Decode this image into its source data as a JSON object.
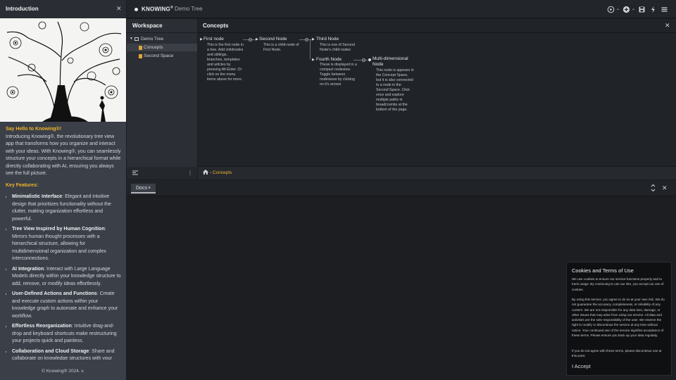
{
  "intro": {
    "title": "Introduction",
    "hello": "Say Hello to Knowing®!",
    "intro_text": "Introducing Knowing®, the revolutionary tree view app that transforms how you organize and interact with your ideas. With Knowing®, you can seamlessly structure your concepts in a hierarchical format while directly collaborating with AI, ensuring you always see the full picture.",
    "features_heading": "Key Features:",
    "features": [
      {
        "name": "Minimalistic Interface",
        "text": ": Elegant and intuitive design that prioritizes functionality without the clutter, making organization effortless and powerful."
      },
      {
        "name": "Tree View Inspired by Human Cognition",
        "text": ": Mirrors human thought processes with a hierarchical structure, allowing for multidimensional organization and complex interconnections."
      },
      {
        "name": "AI Integration",
        "text": ": Interact with Large Language Models directly within your knowledge structure to add, remove, or modify ideas effortlessly."
      },
      {
        "name": "User-Defined Actions and Functions",
        "text": ": Create and execute custom actions within your knowledge graph to automate and enhance your workflow."
      },
      {
        "name": "Effortless Reorganization",
        "text": ": Intuitive drag-and-drop and keyboard shortcuts make restructuring your projects quick and painless."
      },
      {
        "name": "Collaboration and Cloud Storage",
        "text": ": Share and collaborate on knowledge structures with your team, ensuring seamless access and teamwork"
      }
    ],
    "copyright": "© Knowing® 2024. v."
  },
  "topbar": {
    "brand": "KNOWING",
    "brand_mark": "®",
    "tree_name": "Demo Tree"
  },
  "workspace": {
    "title": "Workspace",
    "root": "Demo Tree",
    "items": [
      "Concepts",
      "Second Space"
    ]
  },
  "concepts": {
    "title": "Concepts",
    "breadcrumb": "Concepts",
    "nodes": {
      "first": {
        "title": "First node",
        "desc": "This is the first node in a tree. Add childnodes and siblings, branches, templates and articles by pressing Alt-Enter. Or click on the menu items above for more."
      },
      "second": {
        "title": "Second Node",
        "desc": "This is a child-node of First Node."
      },
      "third": {
        "title": "Third Node",
        "desc": "This is one of Second Node's child-nodes"
      },
      "fourth": {
        "title": "Fourth Node",
        "desc": "These is displayed in a compact nodeview. Toggle between nodeviews by clicking on it's arrows"
      },
      "multi": {
        "title": "Multi-dimensional Node",
        "desc": "This node is appears in the Concept Space, but it is also connected to a node in the Second Space. Click once and explore multiple paths in breadcrumbs at the bottom of the page."
      }
    }
  },
  "docs": {
    "tab": "Docs"
  },
  "cookies": {
    "title": "Cookies and Terms of Use",
    "p1": "We use cookies to ensure our service functions properly and to track usage. By continuing to use our site, you accept our use of cookies.",
    "p2": "By using this service, you agree to do so at your own risk. We do not guarantee the accuracy, completeness, or reliability of any content. We are not responsible for any data loss, damage, or other issues that may arise from using our service. All data and activities are the sole responsibility of the user. We reserve the right to modify or discontinue the service at any time without notice. Your continued use of the service signifies acceptance of these terms. Please ensure you back up your data regularly.",
    "p3": "If you do not agree with these terms, please discontinue use at this point.",
    "accept": "I Accept"
  },
  "colors": {
    "accent": "#f0b42d",
    "panel": "#2b2e34",
    "background": "#1b1d21"
  },
  "icons": [
    "close-icon",
    "play-circle-icon",
    "plus-circle-icon",
    "save-icon",
    "bolt-icon",
    "menu-icon",
    "folder-icon",
    "document-icon",
    "home-icon",
    "expand-collapse-icon"
  ]
}
